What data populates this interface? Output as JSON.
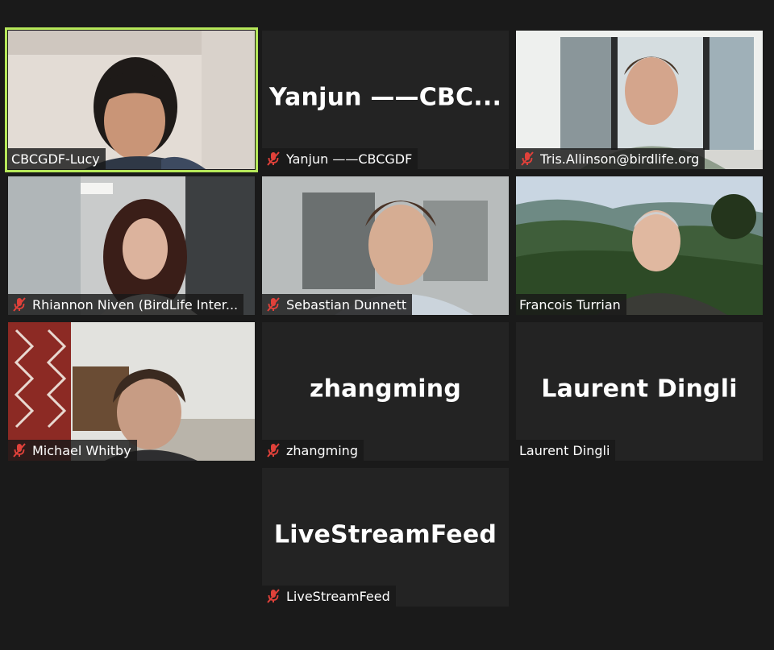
{
  "meeting": {
    "participants": [
      {
        "id": "p1",
        "name": "CBCGDF-Lucy",
        "muted": false,
        "video": true,
        "speaking": true
      },
      {
        "id": "p2",
        "name": "Yanjun ——CBCGDF",
        "display_name": "Yanjun ——CBC...",
        "muted": true,
        "video": false
      },
      {
        "id": "p3",
        "name": "Tris.Allinson@birdlife.org",
        "muted": true,
        "video": true
      },
      {
        "id": "p4",
        "name": "Rhiannon Niven (BirdLife Inter...",
        "muted": true,
        "video": true
      },
      {
        "id": "p5",
        "name": "Sebastian Dunnett",
        "muted": true,
        "video": true
      },
      {
        "id": "p6",
        "name": "Francois Turrian",
        "muted": false,
        "video": true
      },
      {
        "id": "p7",
        "name": "Michael Whitby",
        "muted": true,
        "video": true
      },
      {
        "id": "p8",
        "name": "zhangming",
        "display_name": "zhangming",
        "muted": true,
        "video": false
      },
      {
        "id": "p9",
        "name": "Laurent Dingli",
        "display_name": "Laurent Dingli",
        "muted": false,
        "video": false
      },
      {
        "id": "p10",
        "name": "LiveStreamFeed",
        "display_name": "LiveStreamFeed",
        "muted": true,
        "video": false
      }
    ],
    "colors": {
      "background": "#1a1a1a",
      "tile": "#232323",
      "speaker_border": "#b6e85a",
      "muted_icon": "#e0413a"
    },
    "icons": {
      "muted": "mic-muted-icon"
    }
  }
}
